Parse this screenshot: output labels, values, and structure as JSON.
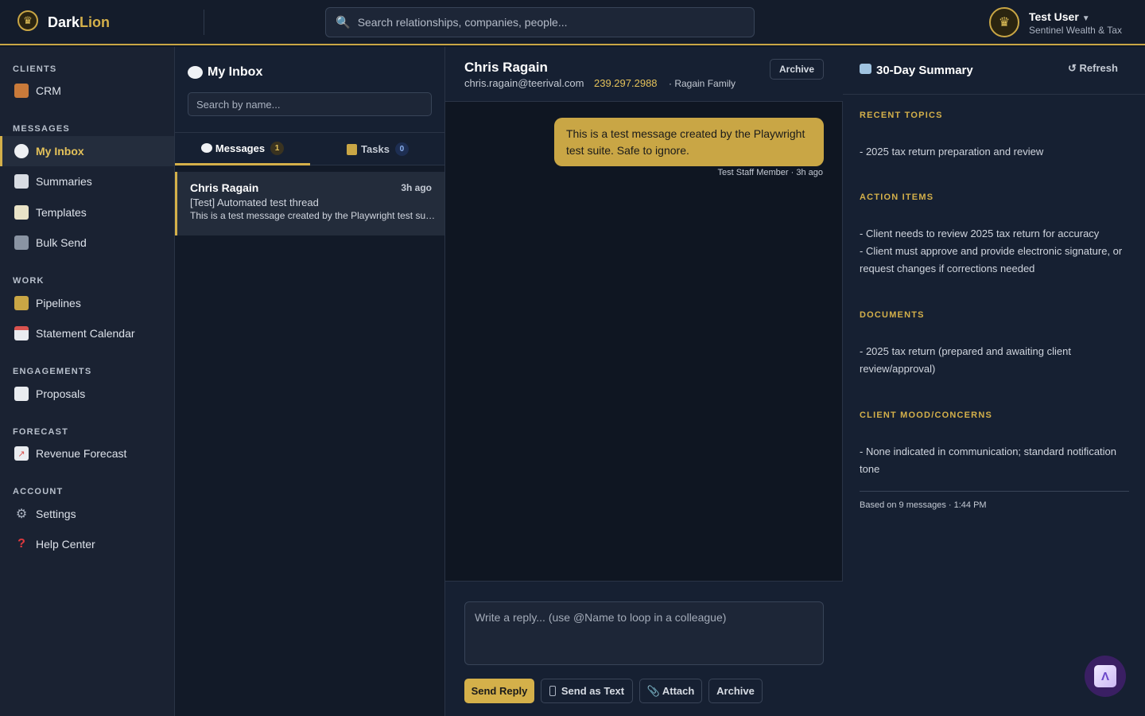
{
  "header": {
    "brand_primary": "Dark",
    "brand_accent": "Lion",
    "search_placeholder": "Search relationships, companies, people...",
    "user_name": "Test User",
    "user_org": "Sentinel Wealth & Tax",
    "accent_color": "#d4b04a"
  },
  "sidebar": {
    "sections": {
      "clients": "CLIENTS",
      "messages": "MESSAGES",
      "work": "WORK",
      "engagements": "ENGAGEMENTS",
      "forecast": "FORECAST",
      "account": "ACCOUNT"
    },
    "items": {
      "crm": "CRM",
      "my_inbox": "My Inbox",
      "summaries": "Summaries",
      "templates": "Templates",
      "bulk_send": "Bulk Send",
      "pipelines": "Pipelines",
      "statement_calendar": "Statement Calendar",
      "proposals": "Proposals",
      "revenue_forecast": "Revenue Forecast",
      "settings": "Settings",
      "help_center": "Help Center"
    },
    "active_item": "My Inbox"
  },
  "inbox": {
    "title": "My Inbox",
    "search_placeholder": "Search by name...",
    "tabs": [
      {
        "label": "Messages",
        "count": "1"
      },
      {
        "label": "Tasks",
        "count": "0"
      }
    ],
    "threads": [
      {
        "name": "Chris Ragain",
        "time": "3h ago",
        "subject": "[Test] Automated test thread",
        "preview": "This is a test message created by the Playwright test suite. Safe to ignore."
      }
    ]
  },
  "conversation": {
    "contact_name": "Chris Ragain",
    "contact_email": "chris.ragain@teerival.com",
    "contact_phone": "239.297.2988",
    "contact_family": "· Ragain Family",
    "archive_label": "Archive",
    "message": {
      "text": "This is a test message created by the Playwright test suite. Safe to ignore.",
      "meta": "Test Staff Member · 3h ago"
    },
    "reply_placeholder": "Write a reply... (use @Name to loop in a colleague)",
    "buttons": {
      "send_reply": "Send Reply",
      "send_as_text": "Send as Text",
      "attach": "Attach",
      "archive": "Archive"
    }
  },
  "summary": {
    "title": "30-Day Summary",
    "refresh": "Refresh",
    "recent_topics_label": "RECENT TOPICS",
    "recent_topics": "- 2025 tax return preparation and review",
    "action_items_label": "ACTION ITEMS",
    "action_item_1": "- Client needs to review 2025 tax return for accuracy",
    "action_item_2": "- Client must approve and provide electronic signature, or request changes if corrections needed",
    "documents_label": "DOCUMENTS",
    "documents": "- 2025 tax return (prepared and awaiting client review/approval)",
    "mood_label": "CLIENT MOOD/CONCERNS",
    "mood": "- None indicated in communication; standard notification tone",
    "footer": "Based on 9 messages · 1:44 PM"
  }
}
